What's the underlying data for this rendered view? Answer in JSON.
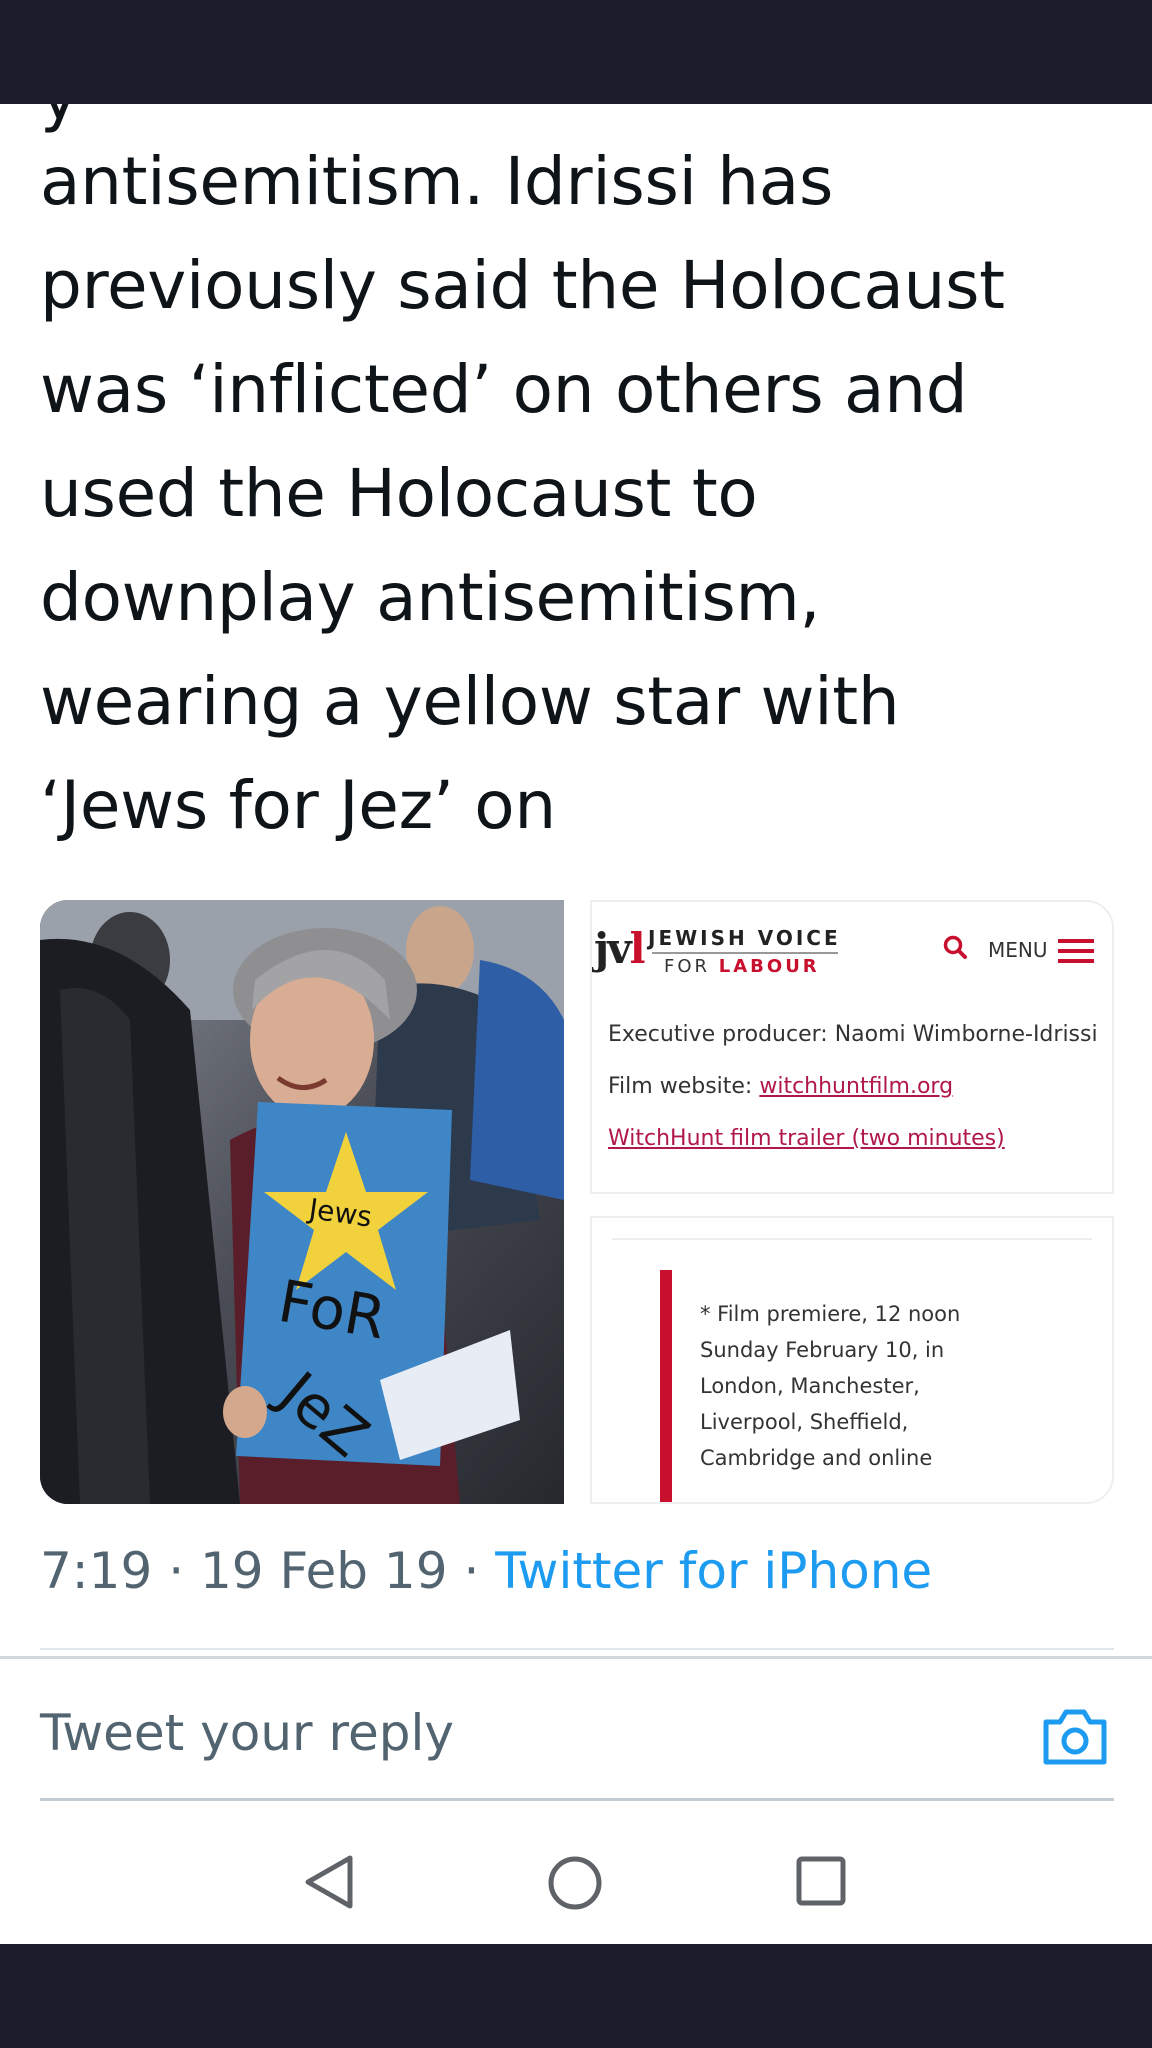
{
  "tweet": {
    "partial_top_line": "y",
    "text_lines": [
      "antisemitism. Idrissi has",
      "previously said the Holocaust",
      "was ‘inflicted’ on others and",
      "used the Holocaust to",
      "downplay antisemitism,",
      "wearing a yellow star with",
      "‘Jews for Jez’ on"
    ],
    "time": "7:19",
    "separator": "·",
    "date": "19 Feb 19",
    "source": "Twitter for iPhone"
  },
  "media": {
    "photo": {
      "sign_star_text": "Jews",
      "sign_text_line1": "FoR",
      "sign_text_line2": "JeZ"
    },
    "jvl_card": {
      "logo": "jv",
      "logo_l": "l",
      "name": "JEWISH VOICE",
      "sub_for": "FOR",
      "sub_labour": "LABOUR",
      "menu_label": "MENU",
      "executive_producer": "Executive producer: Naomi Wimborne-Idrissi",
      "film_website_label": "Film website:",
      "film_website_link": "witchhuntfilm.org",
      "trailer_link": "WitchHunt film trailer (two minutes)"
    },
    "premiere_card": {
      "lines": [
        "* Film premiere, 12 noon",
        "Sunday February 10, in",
        "London, Manchester,",
        "Liverpool, Sheffield,",
        "Cambridge and online"
      ]
    }
  },
  "reply": {
    "placeholder": "Tweet your reply"
  },
  "colors": {
    "link_blue": "#1d9bf0",
    "muted_text": "#536471",
    "jvl_red": "#c8102e",
    "star_yellow": "#f2d23c",
    "sign_blue": "#3f86c6"
  }
}
